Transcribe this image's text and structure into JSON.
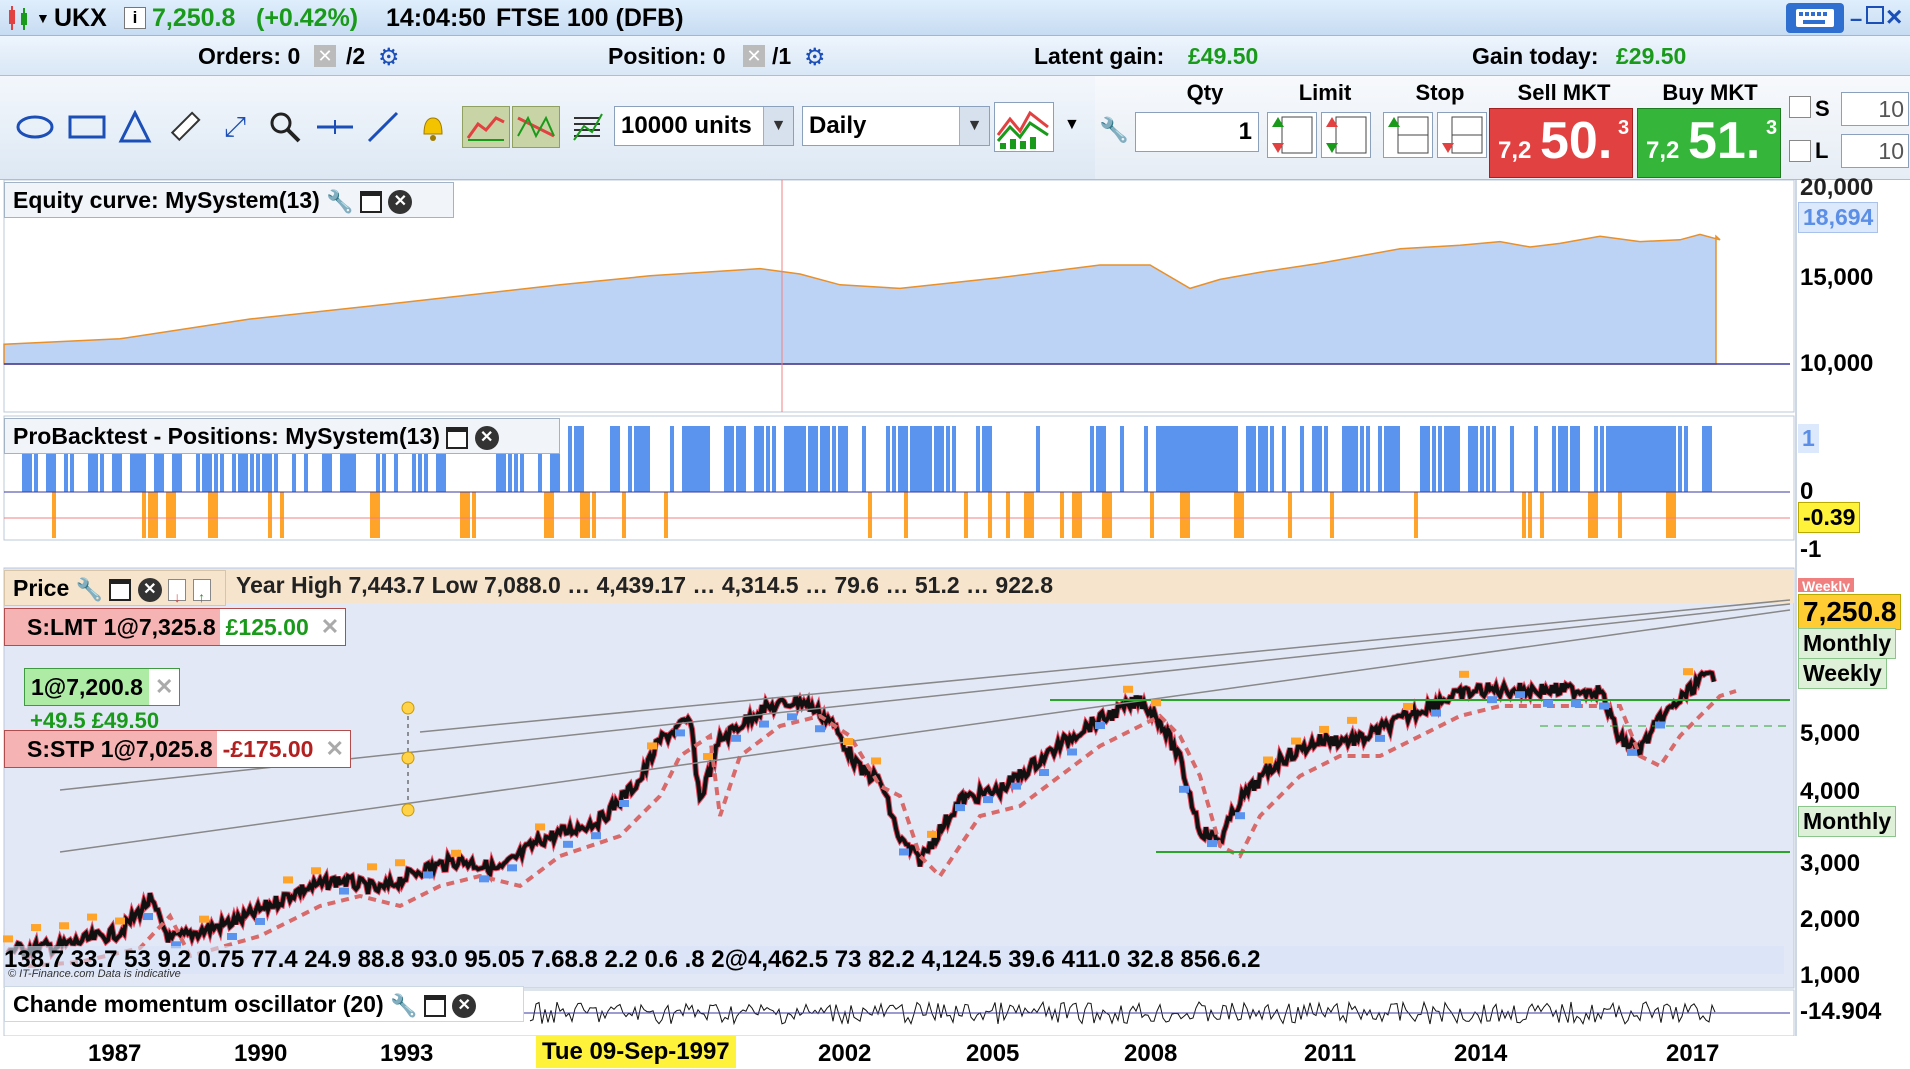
{
  "header": {
    "symbol": "UKX",
    "price": "7,250.8",
    "change": "(+0.42%)",
    "time": "14:04:50",
    "instrument": "FTSE 100 (DFB)"
  },
  "infobar": {
    "orders_label": "Orders: 0",
    "orders_sep": "/2",
    "position_label": "Position: 0",
    "position_sep": "/1",
    "latent_label": "Latent gain:",
    "latent_value": "£49.50",
    "gain_label": "Gain today:",
    "gain_value": "£29.50"
  },
  "toolbar": {
    "units": "10000 units",
    "timeframe": "Daily"
  },
  "trade": {
    "qty_label": "Qty",
    "qty_value": "1",
    "limit_label": "Limit",
    "stop_label": "Stop",
    "sell_label": "Sell MKT",
    "buy_label": "Buy MKT",
    "sell_small": "7,2",
    "sell_big": "50.",
    "sell_sup": "3",
    "buy_small": "7,2",
    "buy_big": "51.",
    "buy_sup": "3",
    "s_label": "S",
    "l_label": "L",
    "s_value": "10",
    "l_value": "10"
  },
  "panels": {
    "equity_title": "Equity curve: MySystem(13)",
    "equity_last": "18,694",
    "equity_axis": [
      "20,000",
      "15,000",
      "10,000"
    ],
    "positions_title": "ProBacktest - Positions: MySystem(13)",
    "positions_axis": [
      "1",
      "0",
      "-1"
    ],
    "positions_last": "-0.39",
    "price_title": "Price",
    "price_overlay_text": "Year High 7,443.7 Low 7,088.0 … 4,439.17 … 4,314.5 … 79.6 … 51.2 … 922.8",
    "price_bottom_text": "138.7 33.7 53 9.2 0.75 77.4 24.9 88.8 93.0 95.05 7.68.8 2.2 0.6 .8 2@4,462.5 73 82.2 4,124.5 39.6 411.0 32.8 856.6.2",
    "price_last": "7,250.8",
    "price_axis": [
      "5,000",
      "4,000",
      "3,000",
      "2,000",
      "1,000"
    ],
    "monthly_label": "Monthly",
    "weekly_label": "Weekly",
    "weekly_top_label": "Weekly",
    "monthly_low_label": "Monthly",
    "cmo_title": "Chande momentum oscillator (20)",
    "cmo_last": "-14.904",
    "watermark": "© IT-Finance.com  Data is indicative"
  },
  "orders": {
    "limit_text": "S:LMT 1@7,325.8",
    "limit_value": "£125.00",
    "position_text": "1@7,200.8",
    "position_value": "+49.5  £49.50",
    "stop_text": "S:STP 1@7,025.8",
    "stop_value": "-£175.00"
  },
  "xaxis": {
    "labels": [
      "1987",
      "1990",
      "1993",
      "2002",
      "2005",
      "2008",
      "2011",
      "2014",
      "2017"
    ],
    "cursor_date": "Tue 09-Sep-1997"
  },
  "colors": {
    "up": "#1a9a1a",
    "sell": "#e24141",
    "buy": "#35b53a",
    "equity_fill": "#bcd3f5",
    "long_bar": "#5b94ee",
    "short_bar": "#ffa329"
  }
}
